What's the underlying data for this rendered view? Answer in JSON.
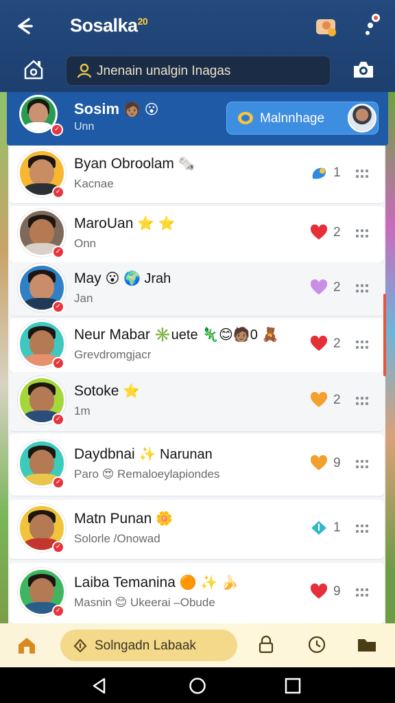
{
  "header": {
    "title": "Sosalka",
    "title_sup": "20",
    "search_placeholder": "Jnenain unalgin Inagas"
  },
  "pinned": {
    "name": "Sosim",
    "emojis": "🧑🏽 😮",
    "subtitle": "Unn",
    "manage_label": "Malnnhage"
  },
  "contacts": [
    {
      "name": "Byan Obroolam",
      "emoji": "🗞️",
      "subtitle": "Kacnae",
      "reaction": "bubble",
      "count": "1",
      "skin": "#c98d63",
      "ring": "#f0a321",
      "shirt": "#2b2f36",
      "bg": "#f7b733"
    },
    {
      "name": "MaroUan",
      "emoji": "⭐ ⭐",
      "subtitle": "Onn",
      "reaction": "heart-red",
      "count": "2",
      "skin": "#b67a52",
      "ring": "#8b6b52",
      "shirt": "#d9d1c7",
      "bg": "#7d6a5a"
    },
    {
      "name": "May",
      "emoji": "😮 🌍 Jrah",
      "subtitle": "Jan",
      "reaction": "heart-purple",
      "count": "2",
      "skin": "#c98d6b",
      "ring": "#2e87c9",
      "shirt": "#1f3956",
      "bg": "#2f80c5"
    },
    {
      "name": "Neur Mabar",
      "emoji": "✳️uete 🦎😊🧑🏽0 🧸",
      "subtitle": "Grevdromgjacr",
      "reaction": "heart-red",
      "count": "2",
      "skin": "#b47a53",
      "ring": "#3fc7c0",
      "shirt": "#e88f6e",
      "bg": "#3fc7c0"
    },
    {
      "name": "Sotoke",
      "emoji": "⭐",
      "subtitle": "1m",
      "reaction": "heart-orange",
      "count": "2",
      "skin": "#b47a53",
      "ring": "#9ed12f",
      "shirt": "#2a4d7a",
      "bg": "#a5d63a"
    },
    {
      "name": "Daydbnai",
      "emoji": "✨ Narunan",
      "subtitle": "Paro",
      "subtitle2": "😍 Remaloeylapiondes",
      "reaction": "heart-orange",
      "count": "9",
      "skin": "#b47a53",
      "ring": "#3ccabb",
      "shirt": "#e9c64a",
      "bg": "#3ccabb"
    },
    {
      "name": "Matn Punan",
      "emoji": "🌼",
      "subtitle": "Solorle /Onowad",
      "reaction": "diamond",
      "count": "1",
      "skin": "#b47a53",
      "ring": "#e4c23a",
      "shirt": "#c3362f",
      "bg": "#f0c43a"
    },
    {
      "name": "Laiba Temanina",
      "emoji": "🟠 ✨ 🍌",
      "subtitle": "Masnin",
      "subtitle2": "😊 Ukeerai –Obude",
      "reaction": "heart-red",
      "count": "9",
      "skin": "#b47a53",
      "ring": "#39b55a",
      "shirt": "#2b5d8a",
      "bg": "#3eb660"
    }
  ],
  "bottom_bar": {
    "pill_label": "Solngadn Labaak"
  },
  "colors": {
    "header": "#23497d",
    "pinned": "#1f5aa6",
    "manage_button": "#3d8de0",
    "heart_red": "#e5303a",
    "heart_orange": "#f2a02e",
    "heart_purple": "#c98ee6",
    "pill": "#f4d98b"
  },
  "icons": [
    "back-icon",
    "profile-icon",
    "settings-icon",
    "home-icon",
    "search-user-icon",
    "camera-icon",
    "more-icon",
    "lock-icon",
    "clock-icon",
    "folder-icon"
  ]
}
